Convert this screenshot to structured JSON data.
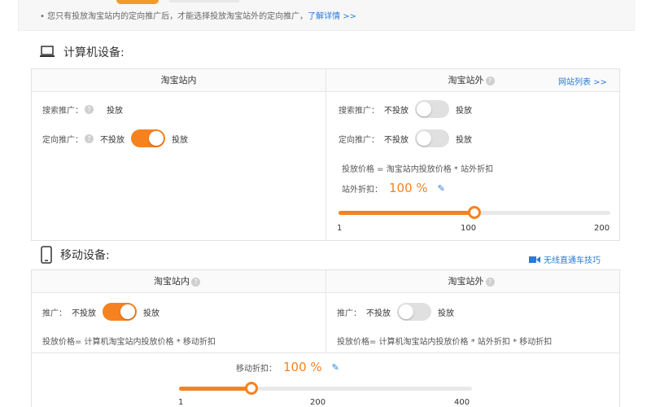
{
  "notice": {
    "text": "您只有投放淘宝站内的定向推广后，才能选择投放淘宝站外的定向推广，",
    "link": "了解详情 >>"
  },
  "pc": {
    "title": "计算机设备:",
    "inside": {
      "header": "淘宝站内",
      "search_label": "搜索推广：",
      "search_value": "投放",
      "targeted_label": "定向推广：",
      "off_label": "不投放",
      "on_label": "投放"
    },
    "outside": {
      "header": "淘宝站外",
      "site_list_link": "网站列表 >>",
      "search_label": "搜索推广：",
      "targeted_label": "定向推广：",
      "off_label": "不投放",
      "on_label": "投放",
      "formula": "投放价格 = 淘宝站内投放价格 * 站外折扣",
      "discount_label": "站外折扣：",
      "discount_value": "100 %",
      "slider": {
        "min": 1,
        "max": 200,
        "value": 100,
        "ticks": [
          "1",
          "100",
          "200"
        ]
      }
    }
  },
  "mobile": {
    "title": "移动设备:",
    "tips_link": "无线直通车技巧",
    "inside": {
      "header": "淘宝站内",
      "promo_label": "推广：",
      "off_label": "不投放",
      "on_label": "投放",
      "formula": "投放价格= 计算机淘宝站内投放价格 * 移动折扣"
    },
    "outside": {
      "header": "淘宝站外",
      "promo_label": "推广：",
      "off_label": "不投放",
      "on_label": "投放",
      "formula": "投放价格= 计算机淘宝站内投放价格 * 站外折扣 * 移动折扣"
    },
    "discount_label": "移动折扣：",
    "discount_value": "100 %",
    "slider": {
      "min": 1,
      "max": 400,
      "value": 100,
      "ticks": [
        "1",
        "200",
        "400"
      ]
    }
  },
  "colors": {
    "accent": "#f6821f",
    "link": "#2b7bd6",
    "toggle_off": "#e0e0e0"
  }
}
